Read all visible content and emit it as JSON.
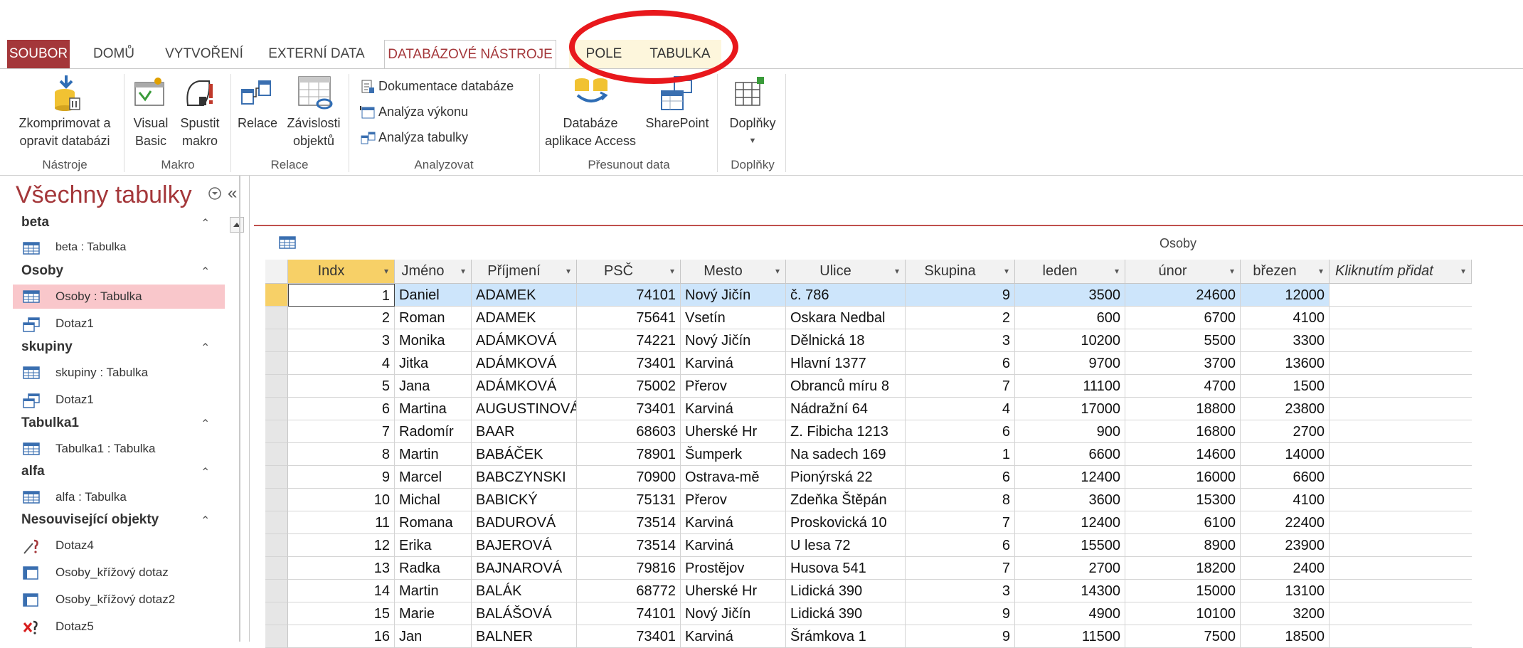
{
  "ribbon": {
    "tabs": {
      "file": "SOUBOR",
      "home": "DOMŮ",
      "create": "VYTVOŘENÍ",
      "external": "EXTERNÍ DATA",
      "dbtools": "DATABÁZOVÉ NÁSTROJE",
      "fields": "POLE",
      "table": "TABULKA"
    },
    "buttons": {
      "compact_l1": "Zkomprimovat a",
      "compact_l2": "opravit databázi",
      "vb_l1": "Visual",
      "vb_l2": "Basic",
      "macro_l1": "Spustit",
      "macro_l2": "makro",
      "rel": "Relace",
      "dep_l1": "Závislosti",
      "dep_l2": "objektů",
      "doc": "Dokumentace databáze",
      "perf": "Analýza výkonu",
      "tbl": "Analýza tabulky",
      "access_l1": "Databáze",
      "access_l2": "aplikace Access",
      "sharepoint": "SharePoint",
      "addins": "Doplňky"
    },
    "groups": {
      "tools": "Nástroje",
      "macro": "Makro",
      "relations": "Relace",
      "analyze": "Analyzovat",
      "move": "Přesunout data",
      "addins": "Doplňky"
    }
  },
  "nav": {
    "title": "Všechny tabulky",
    "groups": [
      {
        "name": "beta",
        "items": [
          "beta : Tabulka"
        ]
      },
      {
        "name": "Osoby",
        "items": [
          "Osoby : Tabulka",
          "Dotaz1"
        ]
      },
      {
        "name": "skupiny",
        "items": [
          "skupiny : Tabulka",
          "Dotaz1"
        ]
      },
      {
        "name": "Tabulka1",
        "items": [
          "Tabulka1 : Tabulka"
        ]
      },
      {
        "name": "alfa",
        "items": [
          "alfa : Tabulka"
        ]
      },
      {
        "name": "Nesouvisející objekty",
        "items": [
          "Dotaz4",
          "Osoby_křížový dotaz",
          "Osoby_křížový dotaz2",
          "Dotaz5"
        ]
      }
    ]
  },
  "document": {
    "tab_title": "Osoby"
  },
  "table": {
    "columns": [
      "Indx",
      "Jméno",
      "Příjmení",
      "PSČ",
      "Mesto",
      "Ulice",
      "Skupina",
      "leden",
      "únor",
      "březen",
      "Kliknutím přidat"
    ],
    "rows": [
      [
        "1",
        "Daniel",
        "ADAMEK",
        "74101",
        "Nový Jičín",
        "č. 786",
        "9",
        "3500",
        "24600",
        "12000"
      ],
      [
        "2",
        "Roman",
        "ADAMEK",
        "75641",
        "Vsetín",
        "Oskara Nedbal",
        "2",
        "600",
        "6700",
        "4100"
      ],
      [
        "3",
        "Monika",
        "ADÁMKOVÁ",
        "74221",
        "Nový Jičín",
        "Dělnická 18",
        "3",
        "10200",
        "5500",
        "3300"
      ],
      [
        "4",
        "Jitka",
        "ADÁMKOVÁ",
        "73401",
        "Karviná",
        "Hlavní 1377",
        "6",
        "9700",
        "3700",
        "13600"
      ],
      [
        "5",
        "Jana",
        "ADÁMKOVÁ",
        "75002",
        "Přerov",
        "Obranců míru 8",
        "7",
        "11100",
        "4700",
        "1500"
      ],
      [
        "6",
        "Martina",
        "AUGUSTINOVÁ",
        "73401",
        "Karviná",
        "Nádražní 64",
        "4",
        "17000",
        "18800",
        "23800"
      ],
      [
        "7",
        "Radomír",
        "BAAR",
        "68603",
        "Uherské Hr",
        "Z. Fibicha 1213",
        "6",
        "900",
        "16800",
        "2700"
      ],
      [
        "8",
        "Martin",
        "BABÁČEK",
        "78901",
        "Šumperk",
        "Na sadech 169",
        "1",
        "6600",
        "14600",
        "14000"
      ],
      [
        "9",
        "Marcel",
        "BABCZYNSKI",
        "70900",
        "Ostrava-mě",
        "Pionýrská 22",
        "6",
        "12400",
        "16000",
        "6600"
      ],
      [
        "10",
        "Michal",
        "BABICKÝ",
        "75131",
        "Přerov",
        "Zdeňka Štěpán",
        "8",
        "3600",
        "15300",
        "4100"
      ],
      [
        "11",
        "Romana",
        "BADUROVÁ",
        "73514",
        "Karviná",
        "Proskovická 10",
        "7",
        "12400",
        "6100",
        "22400"
      ],
      [
        "12",
        "Erika",
        "BAJEROVÁ",
        "73514",
        "Karviná",
        "U lesa 72",
        "6",
        "15500",
        "8900",
        "23900"
      ],
      [
        "13",
        "Radka",
        "BAJNAROVÁ",
        "79816",
        "Prostějov",
        "Husova 541",
        "7",
        "2700",
        "18200",
        "2400"
      ],
      [
        "14",
        "Martin",
        "BALÁK",
        "68772",
        "Uherské Hr",
        "Lidická 390",
        "3",
        "14300",
        "15000",
        "13100"
      ],
      [
        "15",
        "Marie",
        "BALÁŠOVÁ",
        "74101",
        "Nový Jičín",
        "Lidická 390",
        "9",
        "4900",
        "10100",
        "3200"
      ],
      [
        "16",
        "Jan",
        "BALNER",
        "73401",
        "Karviná",
        "Šrámkova 1",
        "9",
        "11500",
        "7500",
        "18500"
      ]
    ]
  },
  "colors": {
    "accent": "#a4373a",
    "selected_header": "#f7d067",
    "selected_row": "#cde5fb",
    "nav_selected": "#f9c7cb",
    "annotation": "#e8181c"
  }
}
